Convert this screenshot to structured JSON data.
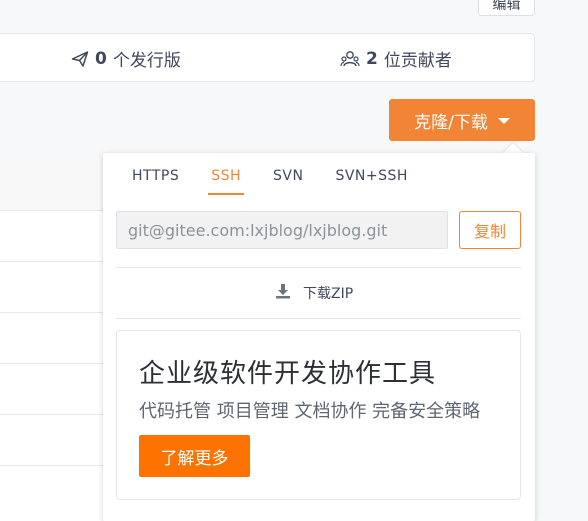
{
  "toolbar": {
    "edit_label": "编辑"
  },
  "stats": {
    "releases_count": "0",
    "releases_label": "个发行版",
    "contributors_count": "2",
    "contributors_label": "位贡献者"
  },
  "clone": {
    "button_label": "克隆/下载",
    "tabs": [
      "HTTPS",
      "SSH",
      "SVN",
      "SVN+SSH"
    ],
    "active_tab": "SSH",
    "url_value": "git@gitee.com:lxjblog/lxjblog.git",
    "copy_label": "复制",
    "download_zip_label": "下载ZIP"
  },
  "promo": {
    "title": "企业级软件开发协作工具",
    "subtitle": "代码托管 项目管理 文档协作 完备安全策略",
    "button_label": "了解更多"
  },
  "colors": {
    "accent": "#f28535",
    "promo_button": "#fe7300"
  }
}
